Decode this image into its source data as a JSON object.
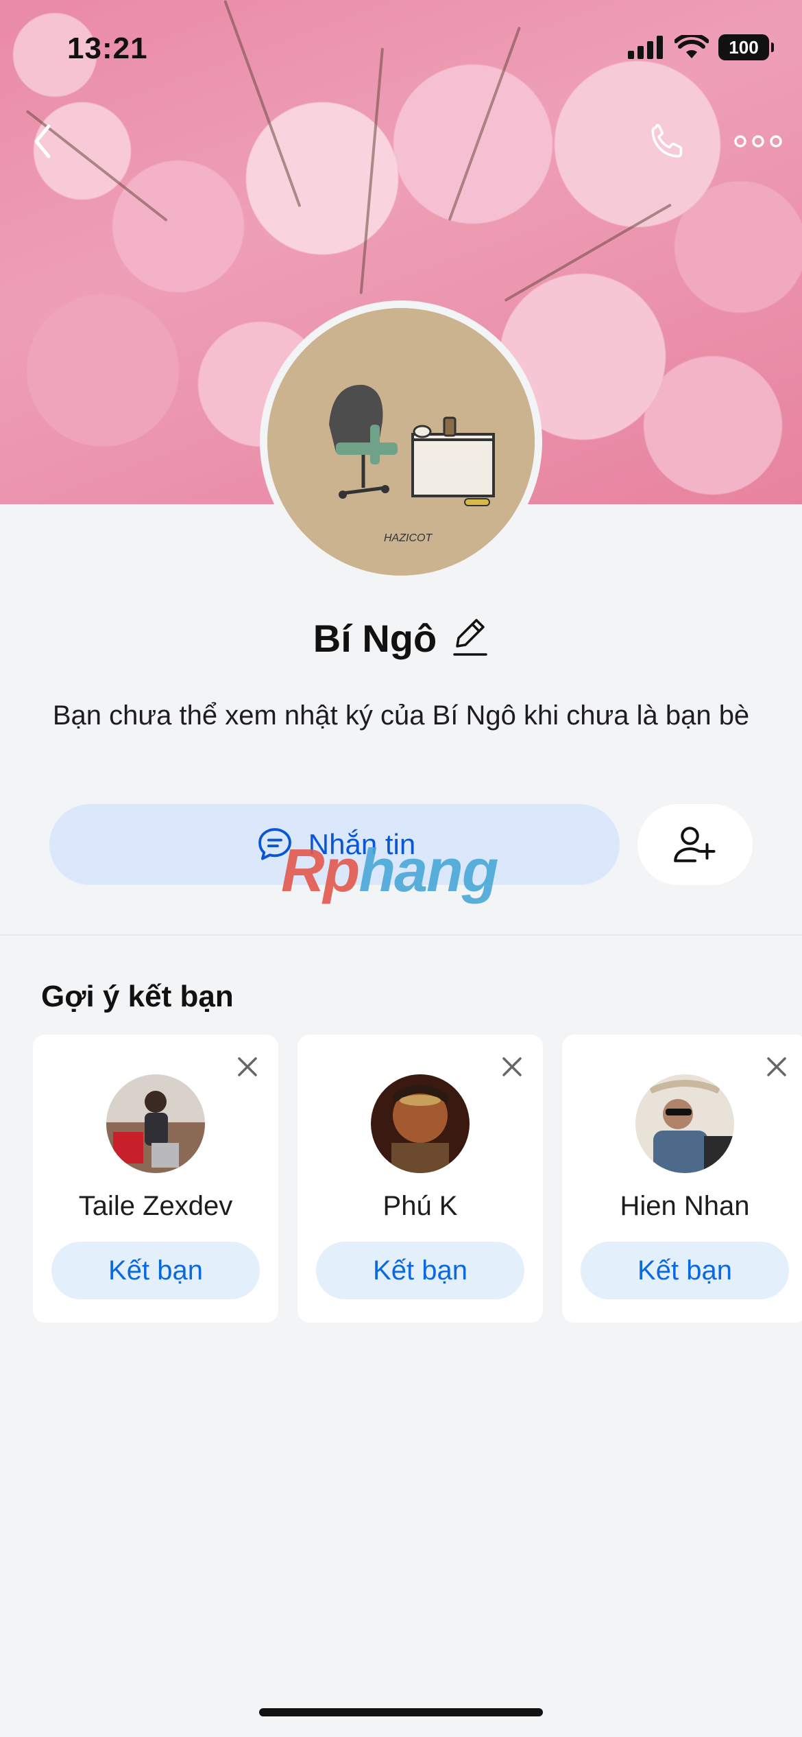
{
  "status_bar": {
    "time": "13:21",
    "battery": "100"
  },
  "header": {
    "back_icon": "chevron-left-icon",
    "call_icon": "phone-icon",
    "more_icon": "more-horizontal-icon"
  },
  "profile": {
    "name": "Bí Ngô",
    "edit_icon": "pencil-icon",
    "avatar_caption": "HAZICOT",
    "notice": "Bạn chưa thể xem nhật ký của Bí Ngô khi chưa là bạn bè"
  },
  "actions": {
    "message_label": "Nhắn tin",
    "message_icon": "chat-bubble-icon",
    "add_friend_icon": "user-plus-icon"
  },
  "watermark": {
    "part1": "Rp",
    "part2": "hang"
  },
  "suggestions": {
    "title": "Gợi ý kết bạn",
    "items": [
      {
        "name": "Taile Zexdev",
        "button": "Kết bạn",
        "avatar_color": "#8a6a55"
      },
      {
        "name": "Phú K",
        "button": "Kết bạn",
        "avatar_color": "#7a3a22"
      },
      {
        "name": "Hien Nhan",
        "button": "Kết bạn",
        "avatar_color": "#6d7f95"
      }
    ]
  },
  "colors": {
    "accent": "#0a68e0",
    "background": "#f3f4f6",
    "cover": "#ee9fb7"
  }
}
